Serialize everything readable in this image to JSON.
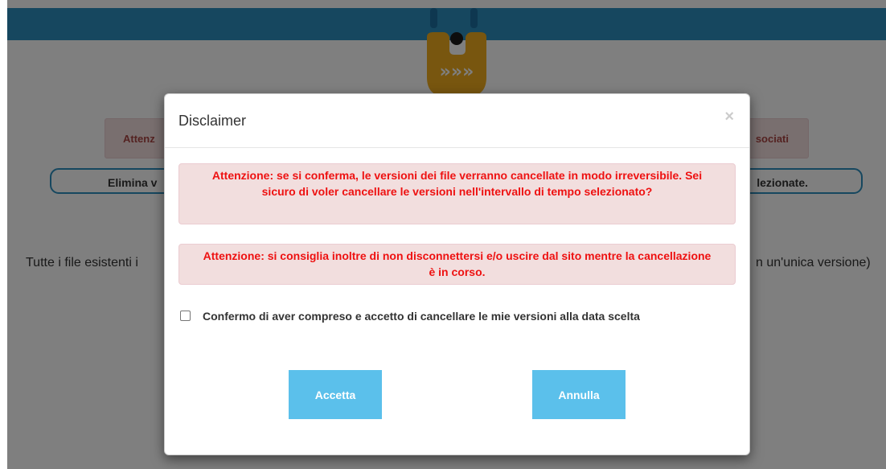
{
  "background": {
    "alert": {
      "left_text": "Attenz",
      "right_text": "sociati"
    },
    "pill": {
      "left_text": "Elimina v",
      "right_text": "lezionate."
    },
    "info": {
      "left_text": "Tutte i file esistenti i",
      "right_text": "n un'unica versione)"
    },
    "logo_glyph": "»»»"
  },
  "modal": {
    "title": "Disclaimer",
    "close_glyph": "×",
    "alert1": "Attenzione: se si conferma, le versioni dei file verranno cancellate in modo irreversibile. Sei sicuro di voler cancellare le versioni nell'intervallo di tempo selezionato?",
    "alert2": "Attenzione: si consiglia inoltre di non disconnettersi e/o uscire dal sito mentre la cancellazione è in corso.",
    "confirm_label": "Confermo di aver compreso e accetto di cancellare le mie versioni alla data scelta",
    "confirm_checked": false,
    "accept_label": "Accetta",
    "cancel_label": "Annulla"
  },
  "colors": {
    "topbar": "#2d8fbf",
    "button": "#5bc0eb",
    "alert_text": "#ee1111",
    "alert_bg": "#f2dede",
    "logo": "#f0ad1e"
  }
}
